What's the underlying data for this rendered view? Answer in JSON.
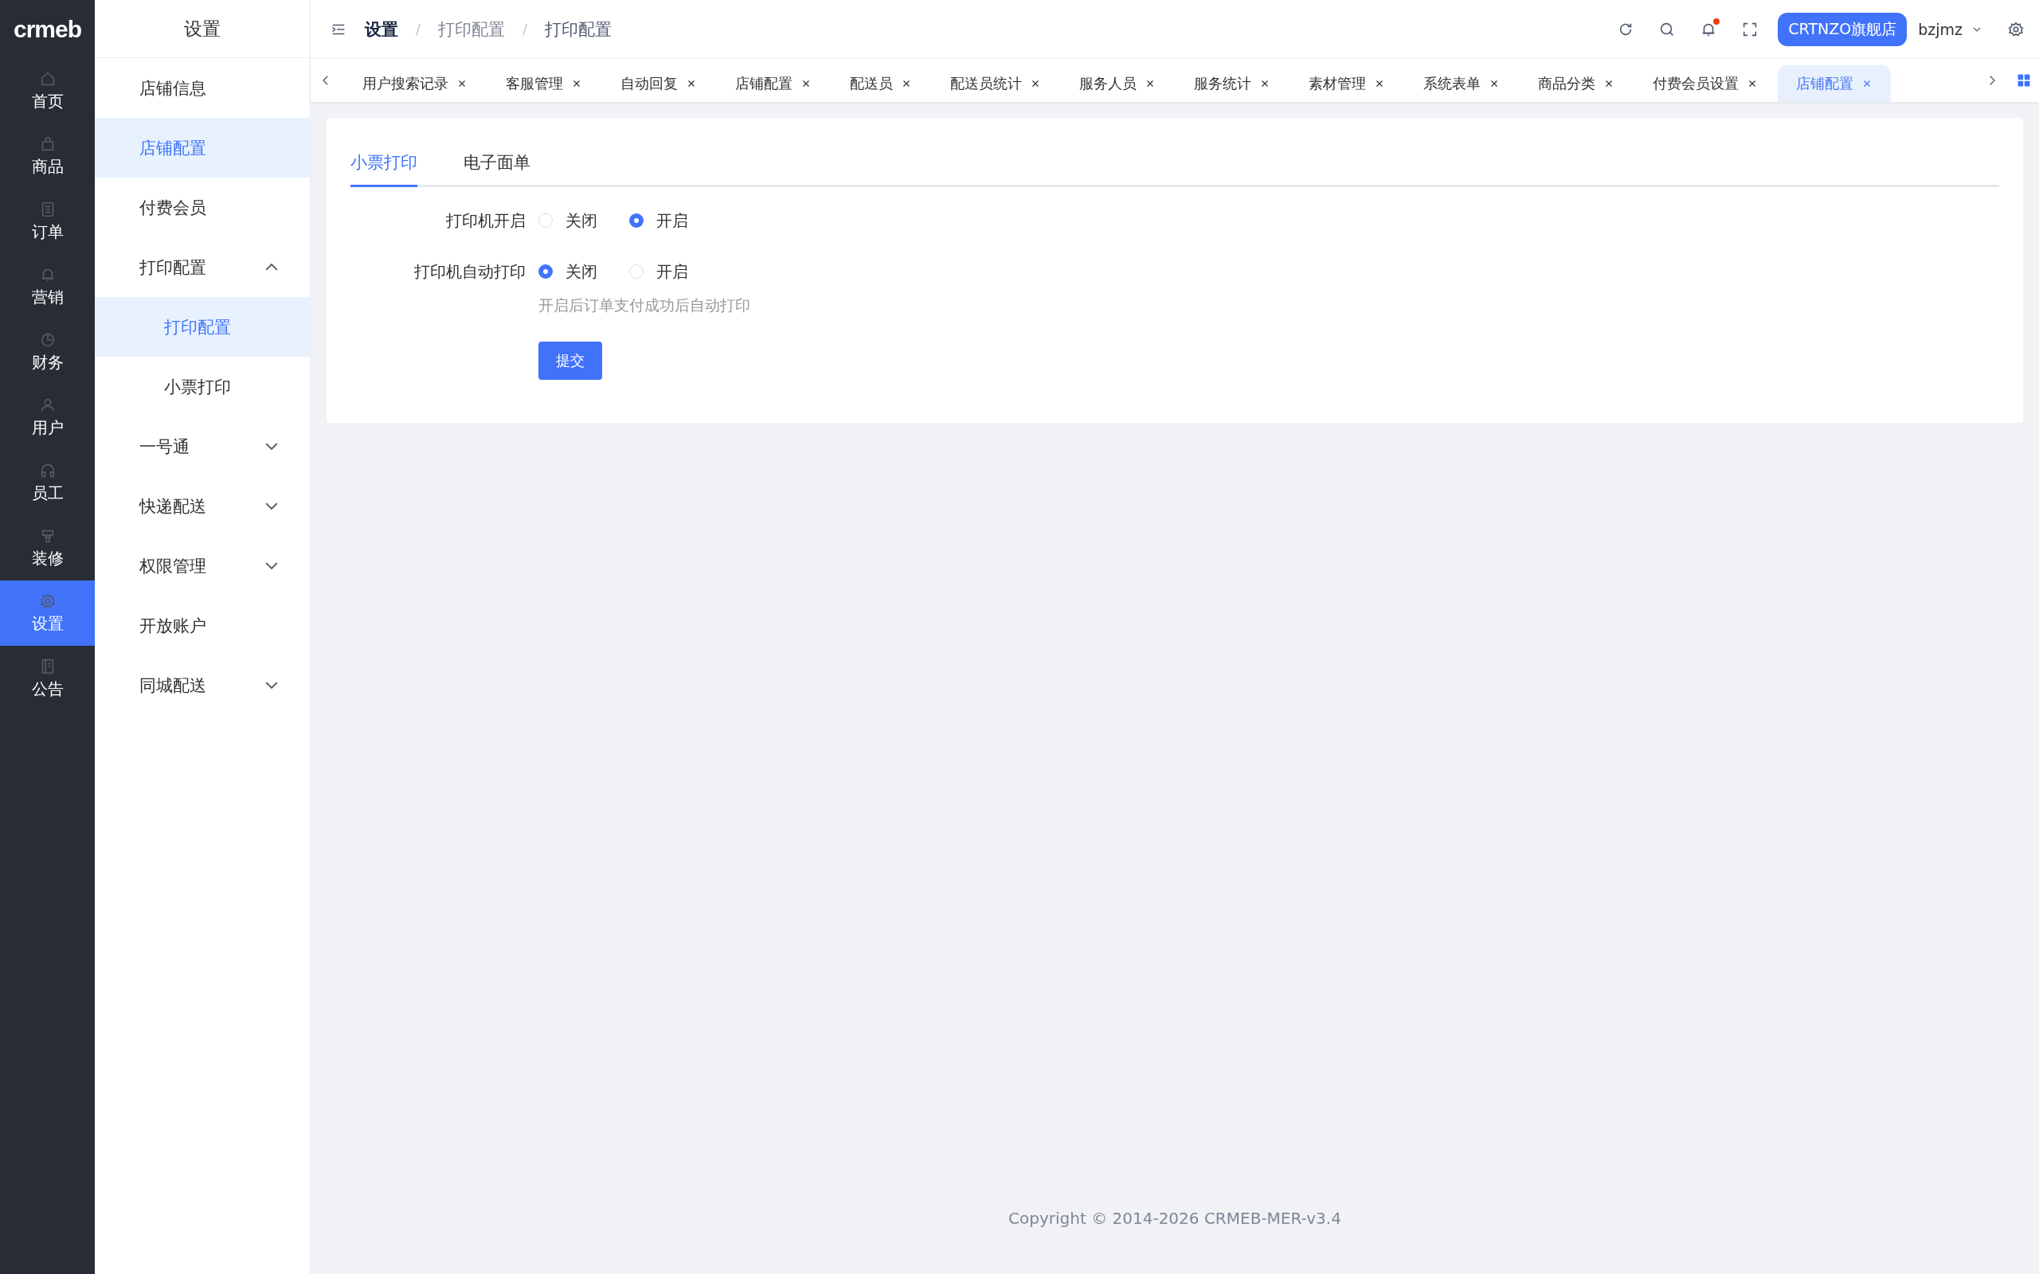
{
  "logo": {
    "text": "crmeb"
  },
  "rail": [
    {
      "label": "首页",
      "selected": false
    },
    {
      "label": "商品",
      "selected": false
    },
    {
      "label": "订单",
      "selected": false
    },
    {
      "label": "营销",
      "selected": false
    },
    {
      "label": "财务",
      "selected": false
    },
    {
      "label": "用户",
      "selected": false
    },
    {
      "label": "员工",
      "selected": false
    },
    {
      "label": "装修",
      "selected": false
    },
    {
      "label": "设置",
      "selected": true
    },
    {
      "label": "公告",
      "selected": false
    }
  ],
  "submenu": {
    "title": "设置",
    "items": [
      {
        "label": "店铺信息",
        "selected": false
      },
      {
        "label": "店铺配置",
        "selected": true
      },
      {
        "label": "付费会员",
        "selected": false
      },
      {
        "label": "打印配置",
        "selected": false,
        "expanded": true,
        "children": [
          {
            "label": "打印配置",
            "selected": true
          },
          {
            "label": "小票打印",
            "selected": false
          }
        ]
      },
      {
        "label": "一号通",
        "selected": false,
        "expanded": false
      },
      {
        "label": "快递配送",
        "selected": false,
        "expanded": false
      },
      {
        "label": "权限管理",
        "selected": false,
        "expanded": false
      },
      {
        "label": "开放账户",
        "selected": false
      },
      {
        "label": "同城配送",
        "selected": false,
        "expanded": false
      }
    ]
  },
  "header": {
    "breadcrumb": [
      "设置",
      "打印配置",
      "打印配置"
    ],
    "separators": [
      "/",
      "/"
    ],
    "has_unread": true,
    "store_button": "CRTNZO旗舰店",
    "user": "bzjmz"
  },
  "tabs": [
    {
      "label": "用户搜索记录",
      "selected": false
    },
    {
      "label": "客服管理",
      "selected": false
    },
    {
      "label": "自动回复",
      "selected": false
    },
    {
      "label": "店铺配置",
      "selected": false
    },
    {
      "label": "配送员",
      "selected": false
    },
    {
      "label": "配送员统计",
      "selected": false
    },
    {
      "label": "服务人员",
      "selected": false
    },
    {
      "label": "服务统计",
      "selected": false
    },
    {
      "label": "素材管理",
      "selected": false
    },
    {
      "label": "系统表单",
      "selected": false
    },
    {
      "label": "商品分类",
      "selected": false
    },
    {
      "label": "付费会员设置",
      "selected": false
    },
    {
      "label": "店铺配置",
      "selected": true
    }
  ],
  "content_tabs": [
    {
      "label": "小票打印",
      "selected": true
    },
    {
      "label": "电子面单",
      "selected": false
    }
  ],
  "form": {
    "fields": [
      {
        "label": "打印机开启",
        "options": [
          {
            "label": "关闭",
            "selected": false
          },
          {
            "label": "开启",
            "selected": true
          }
        ]
      },
      {
        "label": "打印机自动打印",
        "options": [
          {
            "label": "关闭",
            "selected": true
          },
          {
            "label": "开启",
            "selected": false
          }
        ],
        "hint": "开启后订单支付成功后自动打印"
      }
    ],
    "submit": "提交"
  },
  "footer": "Copyright © 2014-2026 CRMEB-MER-v3.4"
}
